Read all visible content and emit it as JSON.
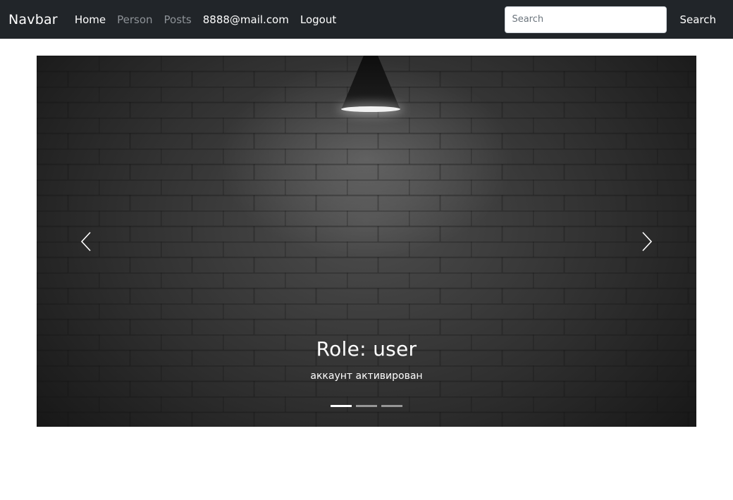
{
  "navbar": {
    "brand": "Navbar",
    "links": [
      {
        "label": "Home",
        "active": true
      },
      {
        "label": "Person",
        "active": false
      },
      {
        "label": "Posts",
        "active": false
      },
      {
        "label": "8888@mail.com",
        "active": true
      },
      {
        "label": "Logout",
        "active": true
      }
    ],
    "search": {
      "placeholder": "Search",
      "button_label": "Search"
    }
  },
  "carousel": {
    "caption_title": "Role: user",
    "caption_text": "аккаунт активирован",
    "indicators": [
      {
        "active": true
      },
      {
        "active": false
      },
      {
        "active": false
      }
    ],
    "icons": {
      "prev": "chevron-left-icon",
      "next": "chevron-right-icon"
    }
  },
  "colors": {
    "navbar_bg": "#212529",
    "link_muted": "#8d9297",
    "text_light": "#ffffff"
  }
}
